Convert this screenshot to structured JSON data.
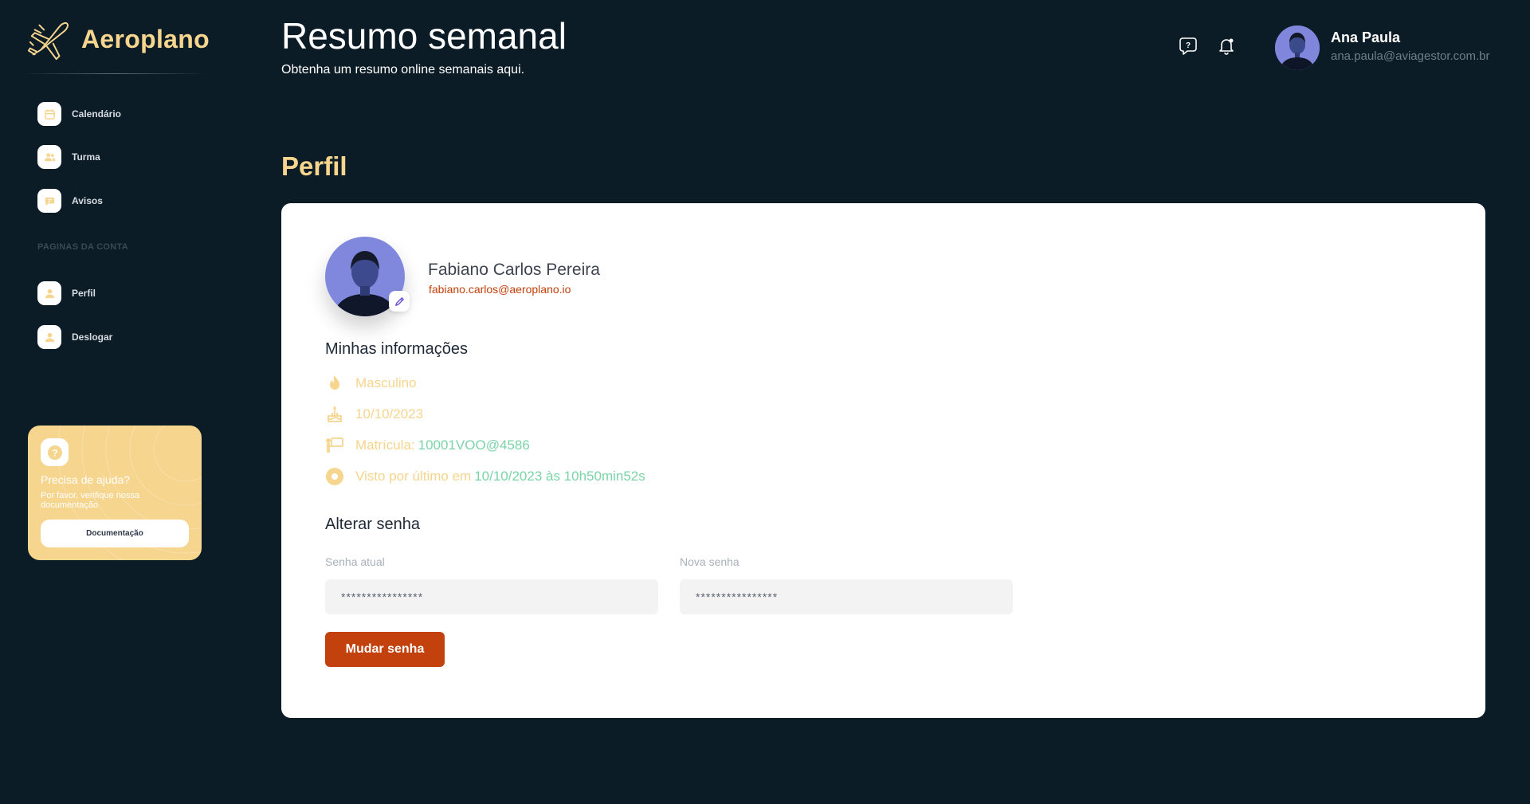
{
  "brand": {
    "name": "Aeroplano"
  },
  "sidebar": {
    "items": [
      {
        "label": "Calendário",
        "icon": "calendar-icon"
      },
      {
        "label": "Turma",
        "icon": "users-icon"
      },
      {
        "label": "Avisos",
        "icon": "message-icon"
      }
    ],
    "section_label": "PAGINAS DA CONTA",
    "account_items": [
      {
        "label": "Perfil",
        "icon": "user-icon"
      },
      {
        "label": "Deslogar",
        "icon": "user-icon"
      }
    ],
    "help": {
      "title": "Precisa de ajuda?",
      "subtitle": "Por favor, verifique nossa documentação",
      "button": "Documentação"
    }
  },
  "header": {
    "title": "Resumo semanal",
    "subtitle": "Obtenha um resumo online semanais aqui.",
    "user": {
      "name": "Ana Paula",
      "email": "ana.paula@aviagestor.com.br"
    }
  },
  "profile": {
    "section_title": "Perfil",
    "name": "Fabiano Carlos Pereira",
    "email": "fabiano.carlos@aeroplano.io",
    "info_title": "Minhas informações",
    "gender": "Masculino",
    "date": "10/10/2023",
    "matricula_label": "Matrícula:",
    "matricula_value": "10001VOO@4586",
    "last_seen_label": "Visto por último em",
    "last_seen_value": "10/10/2023 às 10h50min52s"
  },
  "password": {
    "title": "Alterar senha",
    "current_label": "Senha atual",
    "current_value": "****************",
    "new_label": "Nova senha",
    "new_value": "****************",
    "button": "Mudar senha"
  },
  "colors": {
    "background": "#0c1c26",
    "accent": "#f6d58e",
    "primary": "#c2410c",
    "success": "#7bd4a7"
  }
}
